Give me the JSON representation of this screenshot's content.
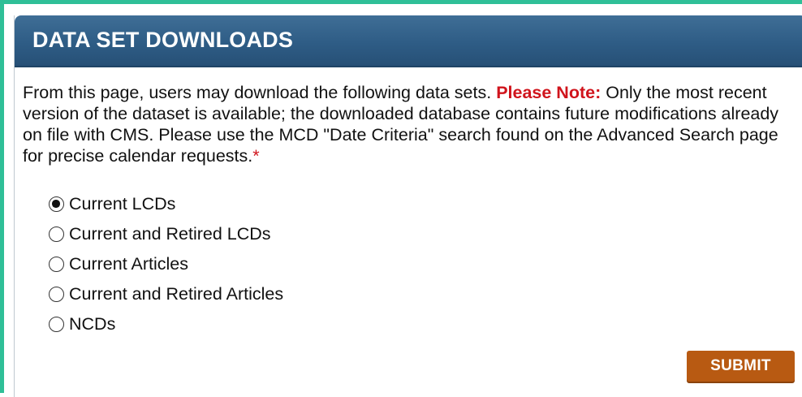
{
  "header": {
    "title": "DATA SET DOWNLOADS"
  },
  "intro": {
    "text_before": "From this page, users may download the following data sets. ",
    "note_label": "Please Note:",
    "text_after": " Only the most recent version of the dataset is available; the downloaded database contains future modifications already on file with CMS. Please use the MCD \"Date Criteria\" search found on the Advanced Search page for precise calendar requests.",
    "asterisk": "*"
  },
  "options": [
    {
      "label": "Current LCDs",
      "selected": true
    },
    {
      "label": "Current and Retired LCDs",
      "selected": false
    },
    {
      "label": "Current Articles",
      "selected": false
    },
    {
      "label": "Current and Retired Articles",
      "selected": false
    },
    {
      "label": "NCDs",
      "selected": false
    }
  ],
  "submit_label": "SUBMIT",
  "colors": {
    "frame_accent": "#2fbf97",
    "header_bg": "#2e5c85",
    "note_red": "#d0141c",
    "submit_bg": "#b85a12"
  }
}
